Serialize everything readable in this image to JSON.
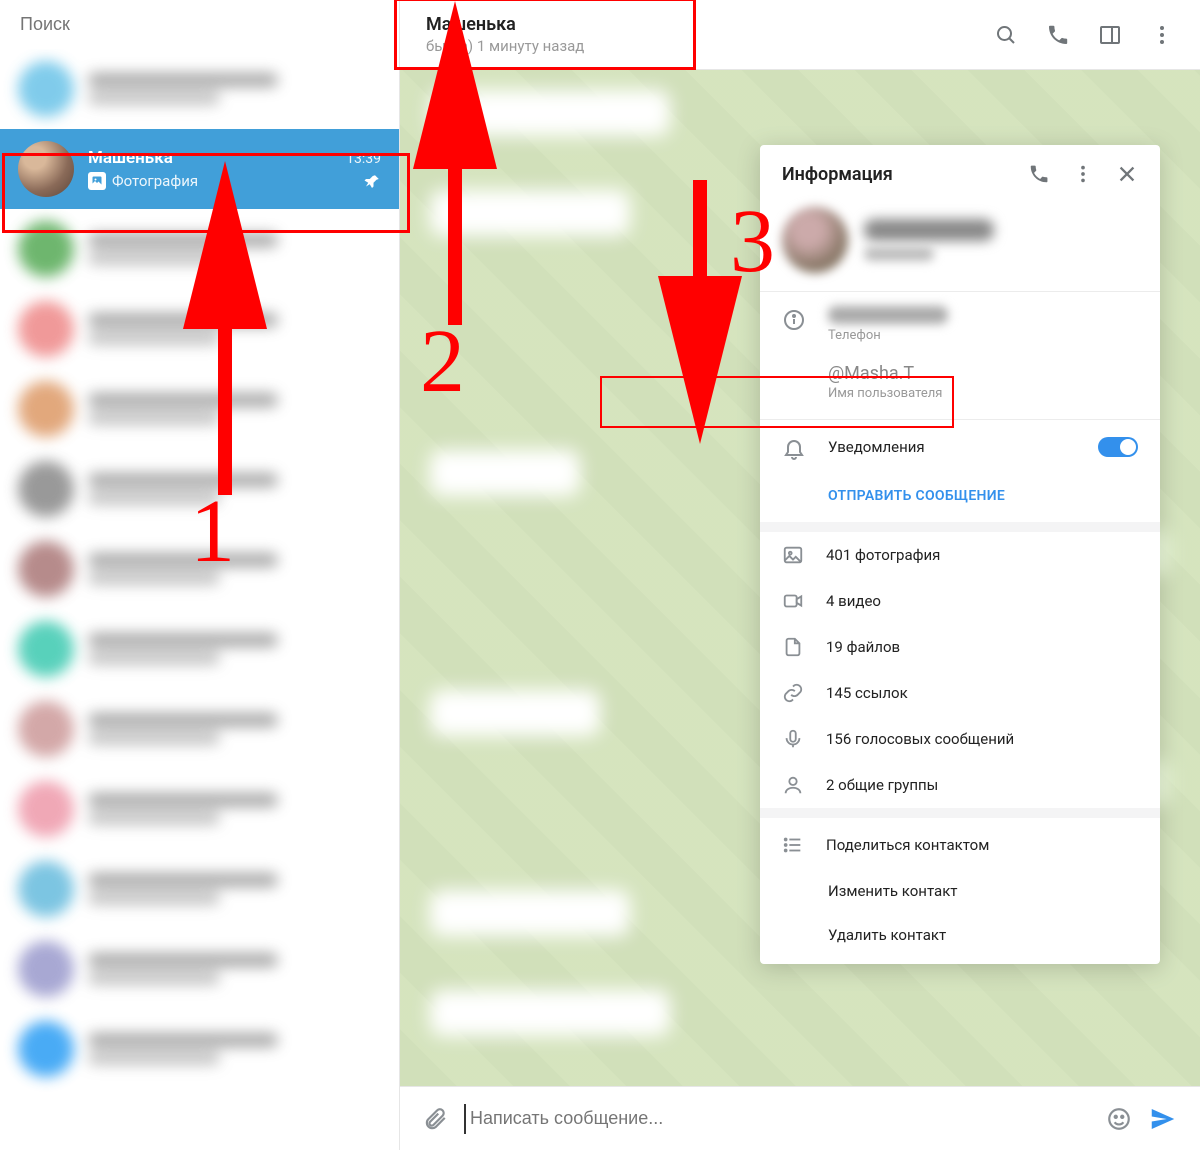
{
  "sidebar": {
    "search_placeholder": "Поиск",
    "selected_chat": {
      "name": "Машенька",
      "time": "13:39",
      "preview": "Фотография"
    }
  },
  "topbar": {
    "title": "Машенька",
    "status": "был(а) 1 минуту назад"
  },
  "info_panel": {
    "title": "Информация",
    "phone_label": "Телефон",
    "username_value": "@Masha.T",
    "username_label": "Имя пользователя",
    "notifications_label": "Уведомления",
    "send_message": "ОТПРАВИТЬ СООБЩЕНИЕ",
    "media": {
      "photos": "401 фотография",
      "videos": "4 видео",
      "files": "19 файлов",
      "links": "145 ссылок",
      "voice": "156 голосовых сообщений",
      "groups": "2 общие группы"
    },
    "actions": {
      "share": "Поделиться контактом",
      "edit": "Изменить контакт",
      "delete": "Удалить контакт"
    }
  },
  "composer": {
    "placeholder": "Написать сообщение..."
  },
  "annotations": {
    "n1": "1",
    "n2": "2",
    "n3": "3"
  }
}
